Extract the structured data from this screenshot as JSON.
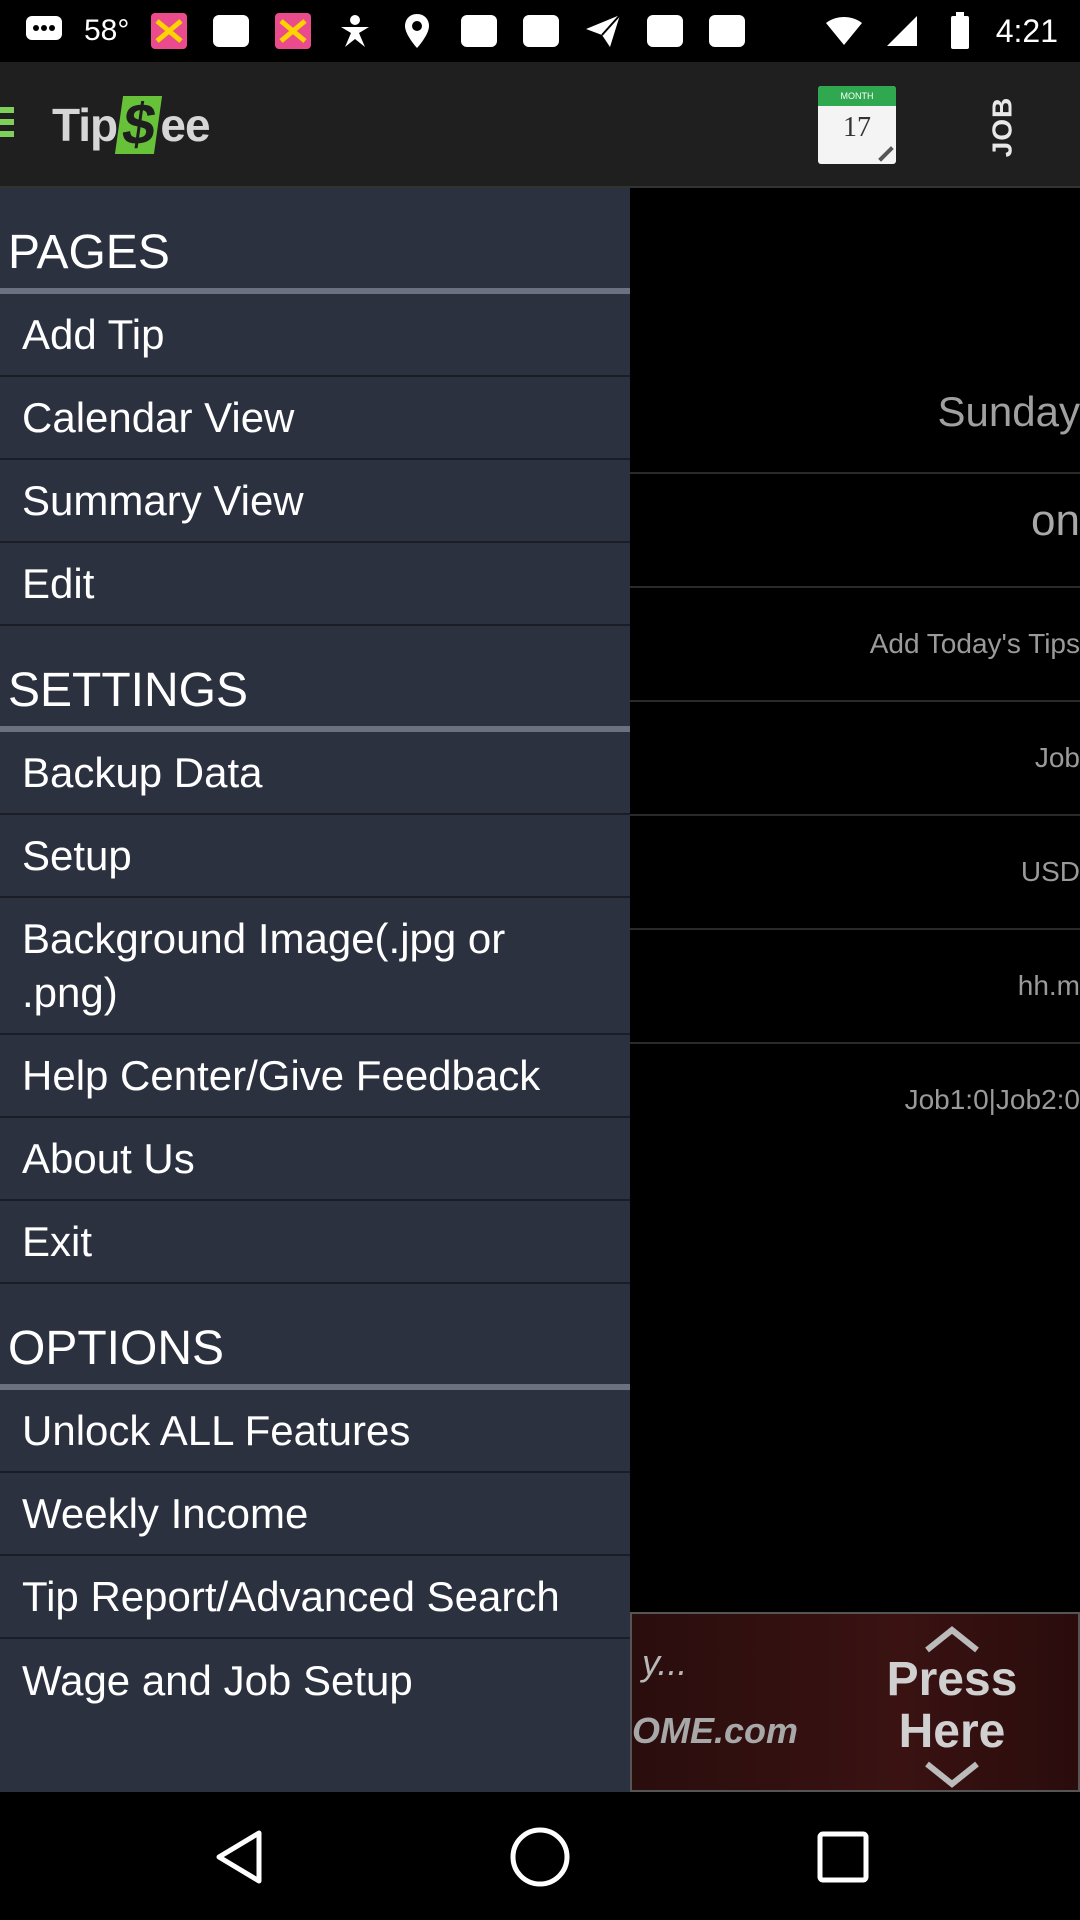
{
  "status_bar": {
    "temperature": "58°",
    "time": "4:21"
  },
  "app_bar": {
    "logo_text_left": "Tip",
    "logo_text_dollar": "$",
    "logo_text_right": "ee",
    "calendar_icon_top": "MONTH",
    "calendar_icon_number": "17",
    "job_label": "JOB"
  },
  "background": {
    "rows": [
      {
        "text": "Sunday"
      },
      {
        "text": "on"
      },
      {
        "text": "Add Today's Tips"
      },
      {
        "text": "Job"
      },
      {
        "text": "USD"
      },
      {
        "text": "hh.m"
      },
      {
        "text": "Job1:0|Job2:0"
      }
    ],
    "ad": {
      "line1": "y...",
      "line2": "OME.com",
      "press_line1": "Press",
      "press_line2": "Here"
    }
  },
  "drawer": {
    "pages_header": "PAGES",
    "pages": [
      {
        "label": "Add Tip"
      },
      {
        "label": "Calendar View"
      },
      {
        "label": "Summary View"
      },
      {
        "label": "Edit"
      }
    ],
    "settings_header": "SETTINGS",
    "settings": [
      {
        "label": "Backup Data"
      },
      {
        "label": "Setup"
      },
      {
        "label": "Background Image(.jpg or .png)"
      },
      {
        "label": "Help Center/Give Feedback"
      },
      {
        "label": "About Us"
      },
      {
        "label": "Exit"
      }
    ],
    "options_header": "OPTIONS",
    "options": [
      {
        "label": "Unlock ALL Features"
      },
      {
        "label": "Weekly Income"
      },
      {
        "label": "Tip Report/Advanced Search"
      },
      {
        "label": "Wage and Job Setup"
      }
    ]
  },
  "colors": {
    "drawer_bg": "#2c3140",
    "accent_green": "#67c23a"
  }
}
